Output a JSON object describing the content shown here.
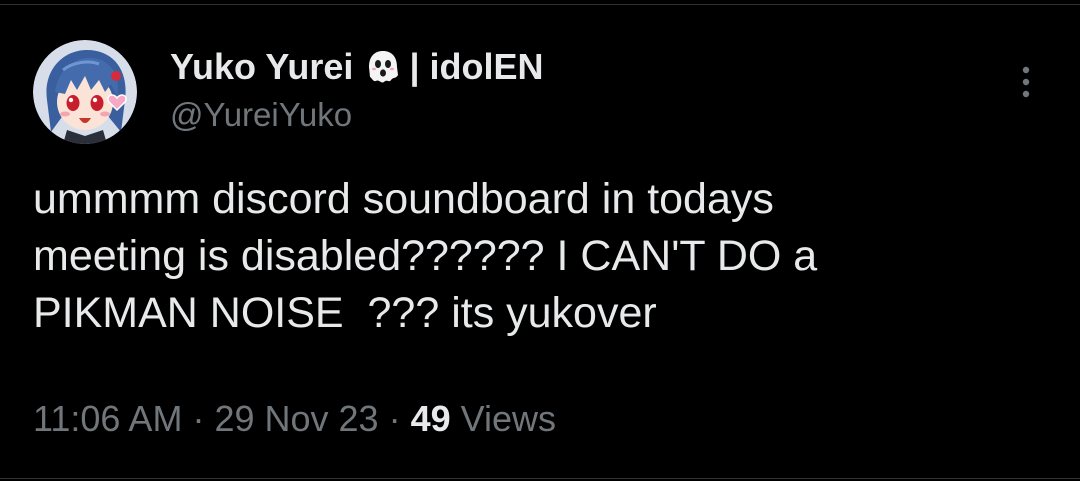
{
  "author": {
    "display_name": "Yuko Yurei",
    "affiliation": "| idolEN",
    "handle": "@YureiYuko",
    "avatar_icon": "anime-avatar",
    "name_emoji_icon": "ghost-icon"
  },
  "tweet": {
    "lines": [
      "ummmm discord soundboard in todays",
      "meeting is disabled?????? I CAN'T DO a",
      "PIKMAN NOISE  ??? its yukover"
    ]
  },
  "meta": {
    "time": "11:06 AM",
    "separator": "·",
    "date": "29 Nov 23",
    "views_count": "49",
    "views_label": "Views"
  },
  "colors": {
    "background": "#000000",
    "primary_text": "#e7e9ea",
    "secondary_text": "#71767b",
    "divider": "#2f3336"
  }
}
